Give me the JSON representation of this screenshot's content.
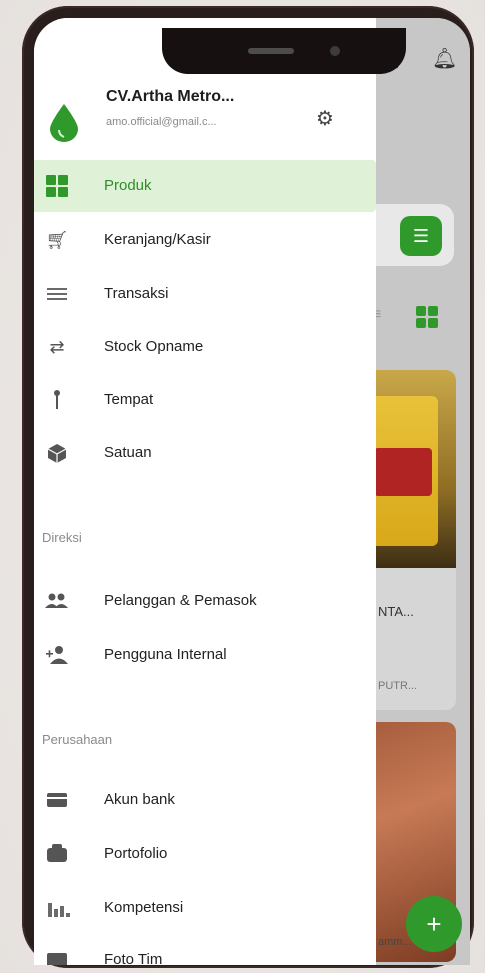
{
  "background_app": {
    "cart_icon": "shopping-cart-icon",
    "bell_icon": "notification-bell-icon",
    "product_card_title": "NTA...",
    "product_card_sub": "PUTR...",
    "product_card2_sub": "amm...",
    "fab_label": "+"
  },
  "drawer": {
    "company_name": "CV.Artha Metro...",
    "company_email": "amo.official@gmail.c...",
    "menu": [
      {
        "label": "Produk",
        "icon": "grid-icon",
        "active": true
      },
      {
        "label": "Keranjang/Kasir",
        "icon": "cart-icon"
      },
      {
        "label": "Transaksi",
        "icon": "list-icon"
      },
      {
        "label": "Stock Opname",
        "icon": "swap-arrows-icon"
      },
      {
        "label": "Tempat",
        "icon": "pin-icon"
      },
      {
        "label": "Satuan",
        "icon": "cube-icon"
      }
    ],
    "section_direksi": "Direksi",
    "direksi_menu": [
      {
        "label": "Pelanggan & Pemasok",
        "icon": "people-icon"
      },
      {
        "label": "Pengguna Internal",
        "icon": "add-person-icon"
      }
    ],
    "section_perusahaan": "Perusahaan",
    "perusahaan_menu": [
      {
        "label": "Akun bank",
        "icon": "credit-card-icon"
      },
      {
        "label": "Portofolio",
        "icon": "briefcase-icon"
      },
      {
        "label": "Kompetensi",
        "icon": "bar-chart-icon"
      },
      {
        "label": "Foto Tim",
        "icon": "photo-icon"
      }
    ]
  },
  "colors": {
    "accent": "#2f9a2b",
    "active_bg": "#dff2d8",
    "phone_frame": "#2a1e1c"
  }
}
